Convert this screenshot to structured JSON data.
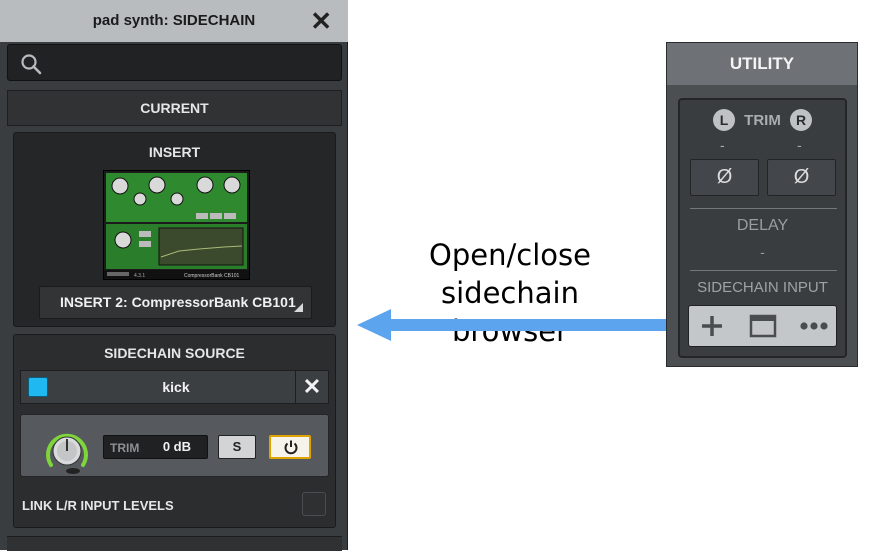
{
  "panel": {
    "title": "pad synth: SIDECHAIN",
    "search_placeholder": "",
    "current_header": "CURRENT",
    "insert": {
      "title": "INSERT",
      "plugin_name": "CompressorBank CB101",
      "plugin_version": "4.3.1",
      "selected": "INSERT 2: CompressorBank CB101"
    },
    "sidechain": {
      "title": "SIDECHAIN SOURCE",
      "source_name": "kick",
      "source_color": "#1fb8f0",
      "trim_label": "TRIM",
      "trim_value": "0 dB",
      "solo_label": "S",
      "link_label": "LINK L/R INPUT LEVELS"
    }
  },
  "callout": {
    "line1": "Open/close",
    "line2": "sidechain browser",
    "arrow_color": "#5da4ef"
  },
  "utility": {
    "title": "UTILITY",
    "left_badge": "L",
    "right_badge": "R",
    "trim_label": "TRIM",
    "left_value": "-",
    "right_value": "-",
    "phase_left": "Ø",
    "phase_right": "Ø",
    "delay_label": "DELAY",
    "delay_value": "-",
    "sidechain_input_label": "SIDECHAIN INPUT"
  }
}
